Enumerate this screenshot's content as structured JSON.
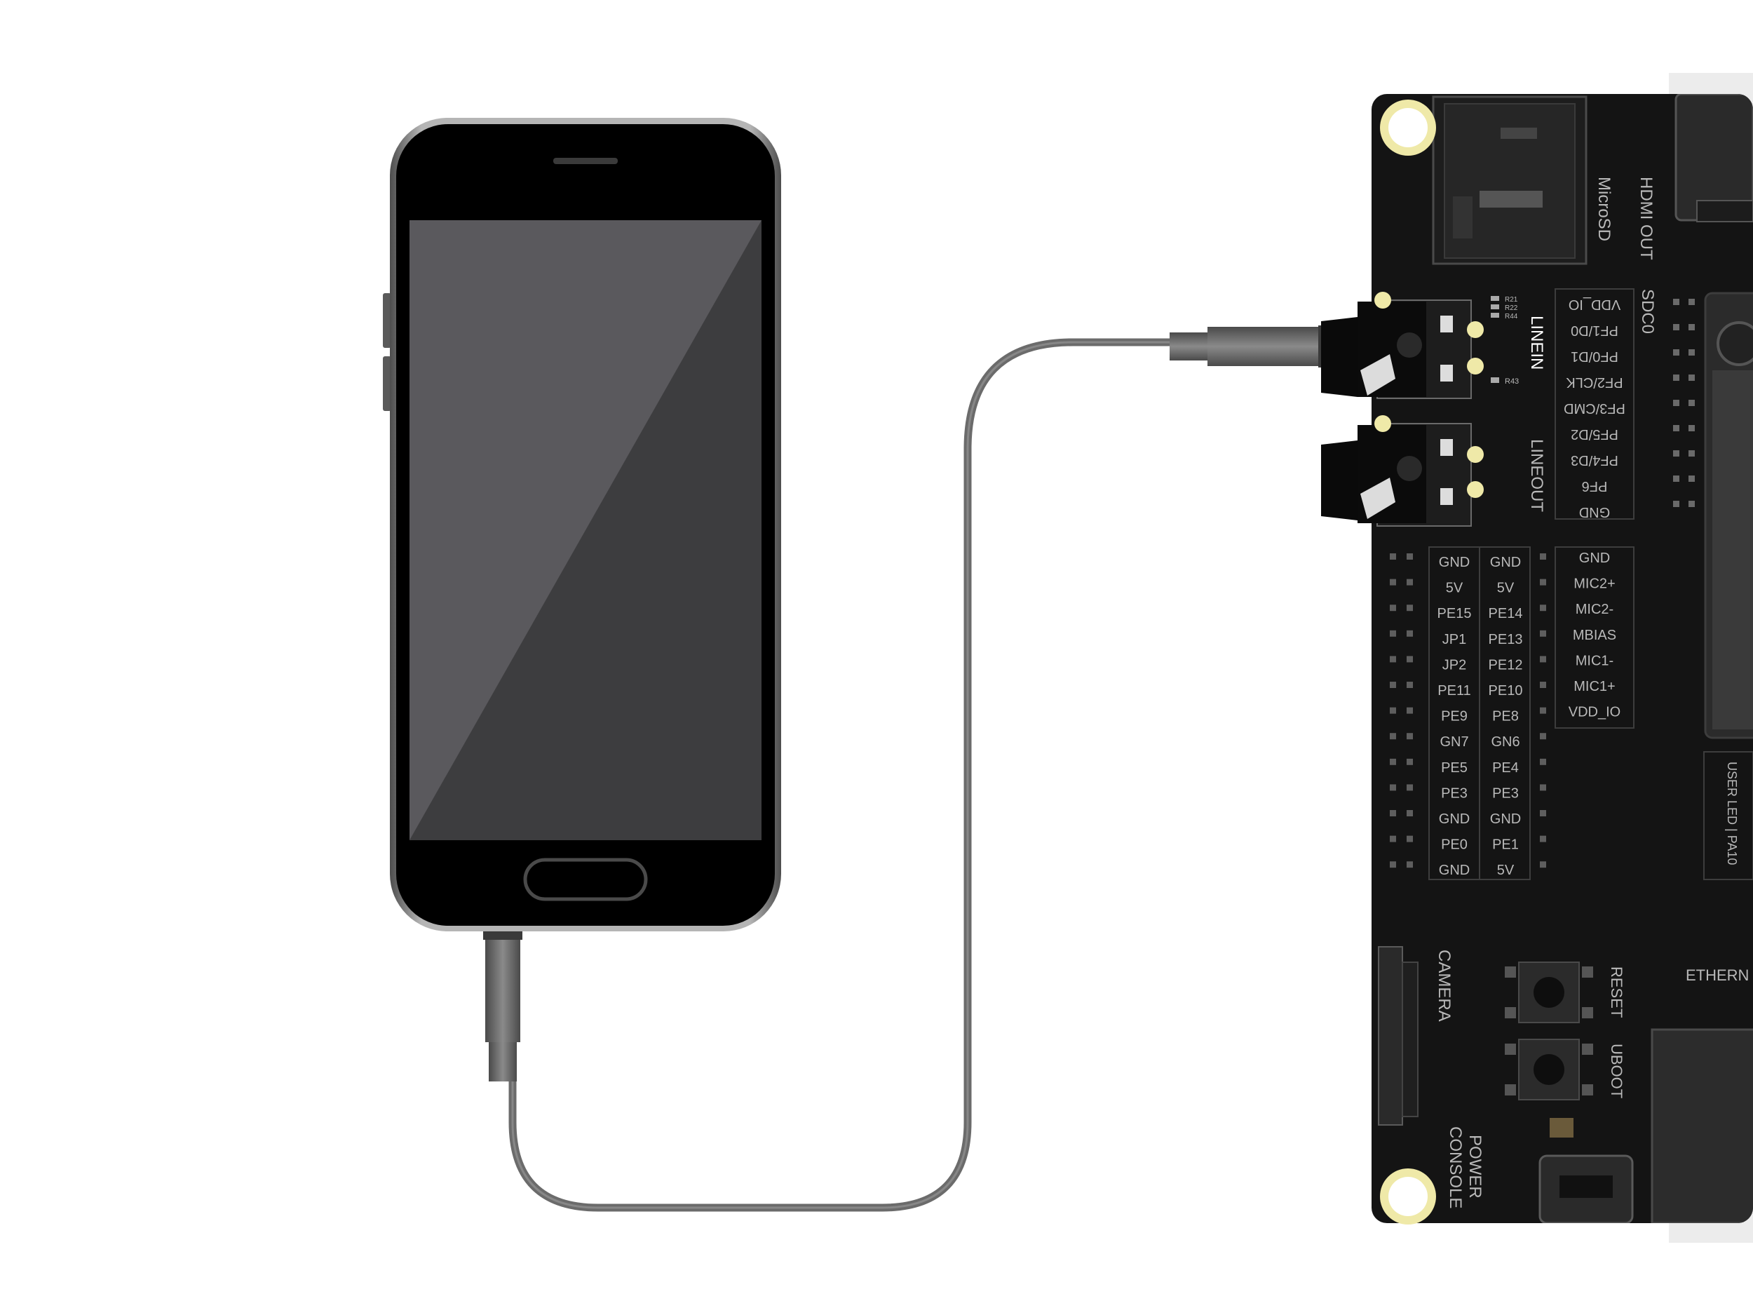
{
  "colors": {
    "background": "#ffffff",
    "phone_body": "#000000",
    "phone_bezel": "#7a7a7a",
    "screen_dark": "#3d3d3f",
    "screen_light": "#5a595d",
    "cable": "#6e6e6e",
    "pcb": "#141414",
    "silkscreen": "#b9b9b9",
    "mount_hole": "#efe9a8"
  },
  "board": {
    "top_labels": {
      "hdmi": "HDMI OUT",
      "microsd": "MicroSD",
      "sdc0": "SDC0"
    },
    "sdc0_pins": [
      "VDD_IO",
      "PF1/D0",
      "PF0/D1",
      "PF2/CLK",
      "PF3/CMD",
      "PF5/D2",
      "PF4/D3",
      "PF6",
      "GND"
    ],
    "resistors_top": [
      "R21",
      "R22",
      "R44"
    ],
    "resistor_r43": "R43",
    "audio": {
      "linein": "LINEIN",
      "lineout": "LINEOUT"
    },
    "header_left": [
      "GND",
      "5V",
      "PE15",
      "JP1",
      "JP2",
      "PE11",
      "PE9",
      "GN7",
      "PE5",
      "PE3",
      "GND",
      "PE0",
      "GND"
    ],
    "header_right": [
      "GND",
      "5V",
      "PE14",
      "PE13",
      "PE12",
      "PE10",
      "PE8",
      "GN6",
      "PE4",
      "PE3",
      "GND",
      "PE1",
      "5V"
    ],
    "mic_pins": [
      "GND",
      "MIC2+",
      "MIC2-",
      "MBIAS",
      "MIC1-",
      "MIC1+",
      "VDD_IO"
    ],
    "user_led": "USER LED | PA10",
    "camera": "CAMERA",
    "reset": "RESET",
    "uboot": "UBOOT",
    "power": "POWER",
    "console": "CONSOLE",
    "ethernet": "ETHERN"
  }
}
